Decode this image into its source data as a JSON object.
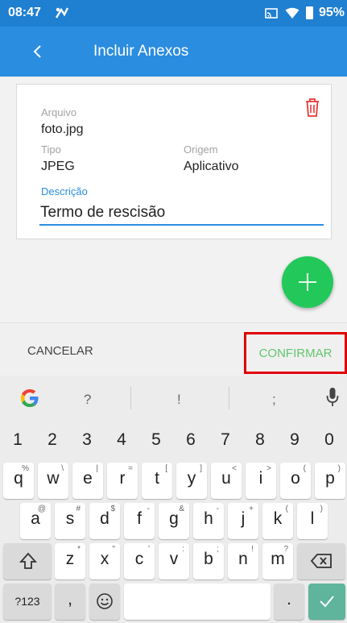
{
  "status_bar": {
    "time": "08:47",
    "battery": "95%",
    "icons": [
      "app-notification-icon",
      "cast-icon",
      "wifi-icon",
      "battery-icon"
    ]
  },
  "app_bar": {
    "title": "Incluir Anexos",
    "back_icon": "chevron-left-icon",
    "color": "#2b8de0"
  },
  "attachment": {
    "file_label": "Arquivo",
    "file_value": "foto.jpg",
    "type_label": "Tipo",
    "type_value": "JPEG",
    "origin_label": "Origem",
    "origin_value": "Aplicativo",
    "description_label": "Descrição",
    "description_value": "Termo de rescisão",
    "delete_icon": "trash-icon"
  },
  "fab": {
    "icon": "plus-icon",
    "color": "#22c95a"
  },
  "actions": {
    "cancel": "CANCELAR",
    "confirm": "CONFIRMAR",
    "confirm_color": "#62c56f",
    "highlight_color": "#e00000"
  },
  "keyboard": {
    "suggestions": [
      "?",
      "!",
      ";"
    ],
    "number_row": [
      "1",
      "2",
      "3",
      "4",
      "5",
      "6",
      "7",
      "8",
      "9",
      "0"
    ],
    "row1": [
      "q",
      "w",
      "e",
      "r",
      "t",
      "y",
      "u",
      "i",
      "o",
      "p"
    ],
    "row1_alt": [
      "%",
      "\\",
      "|",
      "=",
      "[",
      "]",
      "<",
      ">",
      "(",
      ")"
    ],
    "row2": [
      "a",
      "s",
      "d",
      "f",
      "g",
      "h",
      "j",
      "k",
      "l"
    ],
    "row2_alt": [
      "@",
      "#",
      "$",
      "-",
      "&",
      "-",
      "+",
      "(",
      ")"
    ],
    "row3": [
      "z",
      "x",
      "c",
      "v",
      "b",
      "n",
      "m"
    ],
    "row3_alt": [
      "*",
      "\"",
      "'",
      ":",
      ";",
      "!",
      "?"
    ],
    "symbols_key": "?123",
    "comma_key": ",",
    "period_key": ".",
    "enter_color": "#5fb49c"
  }
}
